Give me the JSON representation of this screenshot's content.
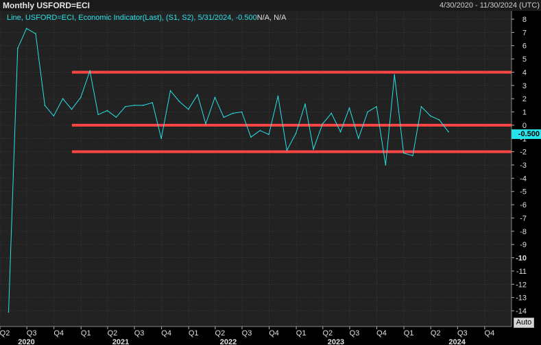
{
  "header": {
    "title": "Monthly USFORD=ECI",
    "date_range": "4/30/2020 - 11/30/2024 (UTC)"
  },
  "legend": {
    "text": "Line, USFORD=ECI, Economic Indicator(Last), (S1, S2), 5/31/2024, -0.500",
    "na_text": "N/A, N/A"
  },
  "last_value_label": "-0.500",
  "auto_label": "Auto",
  "colors": {
    "background": "#000000",
    "plot_background": "#222222",
    "grid": "#3a3a3a",
    "series": "#29e3ea",
    "horizontal_lines": "#ff4444",
    "axis_text": "#e0e0e0"
  },
  "chart_data": {
    "type": "line",
    "title": "Monthly USFORD=ECI",
    "ylim": [
      -14.5,
      8.5
    ],
    "y_ticks": [
      8,
      7,
      6,
      5,
      4,
      3,
      2,
      1,
      0,
      -1,
      -2,
      -3,
      -4,
      -5,
      -6,
      -7,
      -8,
      -9,
      -10,
      -11,
      -12,
      -13,
      -14
    ],
    "x_range": [
      "2020-04-01",
      "2024-12-31"
    ],
    "x_quarter_ticks": [
      {
        "label": "Q2",
        "date": "2020-04-01"
      },
      {
        "label": "Q3",
        "date": "2020-07-01"
      },
      {
        "label": "Q4",
        "date": "2020-10-01"
      },
      {
        "label": "Q1",
        "date": "2021-01-01"
      },
      {
        "label": "Q2",
        "date": "2021-04-01"
      },
      {
        "label": "Q3",
        "date": "2021-07-01"
      },
      {
        "label": "Q4",
        "date": "2021-10-01"
      },
      {
        "label": "Q1",
        "date": "2022-01-01"
      },
      {
        "label": "Q2",
        "date": "2022-04-01"
      },
      {
        "label": "Q3",
        "date": "2022-07-01"
      },
      {
        "label": "Q4",
        "date": "2022-10-01"
      },
      {
        "label": "Q1",
        "date": "2023-01-01"
      },
      {
        "label": "Q2",
        "date": "2023-04-01"
      },
      {
        "label": "Q3",
        "date": "2023-07-01"
      },
      {
        "label": "Q4",
        "date": "2023-10-01"
      },
      {
        "label": "Q1",
        "date": "2024-01-01"
      },
      {
        "label": "Q2",
        "date": "2024-04-01"
      },
      {
        "label": "Q3",
        "date": "2024-07-01"
      },
      {
        "label": "Q4",
        "date": "2024-10-01"
      }
    ],
    "x_year_labels": [
      {
        "label": "2020",
        "date": "2020-08-15"
      },
      {
        "label": "2021",
        "date": "2021-07-01"
      },
      {
        "label": "2022",
        "date": "2022-07-01"
      },
      {
        "label": "2023",
        "date": "2023-07-01"
      },
      {
        "label": "2024",
        "date": "2024-08-15"
      }
    ],
    "series": [
      {
        "x": [
          "2020-04-30",
          "2020-05-31",
          "2020-06-30",
          "2020-07-31",
          "2020-08-31",
          "2020-09-30",
          "2020-10-31",
          "2020-11-30",
          "2020-12-31",
          "2021-01-31",
          "2021-02-28",
          "2021-03-31",
          "2021-04-30",
          "2021-05-31",
          "2021-06-30",
          "2021-07-31",
          "2021-08-31",
          "2021-09-30",
          "2021-10-31",
          "2021-11-30",
          "2021-12-31",
          "2022-01-31",
          "2022-02-28",
          "2022-03-31",
          "2022-04-30",
          "2022-05-31",
          "2022-06-30",
          "2022-07-31",
          "2022-08-31",
          "2022-09-30",
          "2022-10-31",
          "2022-11-30",
          "2022-12-31",
          "2023-01-31",
          "2023-02-28",
          "2023-03-31",
          "2023-04-30",
          "2023-05-31",
          "2023-06-30",
          "2023-07-31",
          "2023-08-31",
          "2023-09-30",
          "2023-10-31",
          "2023-11-30",
          "2023-12-31",
          "2024-01-31",
          "2024-02-29",
          "2024-03-31",
          "2024-04-30",
          "2024-05-31"
        ],
        "values": [
          -14.1,
          5.8,
          7.3,
          6.9,
          1.5,
          0.7,
          2.0,
          1.2,
          2.1,
          4.1,
          0.8,
          1.1,
          0.6,
          1.4,
          1.5,
          1.5,
          1.7,
          -1.0,
          2.6,
          1.8,
          1.2,
          2.3,
          0.1,
          2.1,
          0.6,
          0.9,
          1.0,
          -0.9,
          -0.4,
          -0.7,
          2.2,
          -1.9,
          -0.6,
          1.6,
          -1.8,
          0.1,
          0.9,
          -0.5,
          1.3,
          -1.0,
          1.0,
          1.4,
          -3.0,
          3.8,
          -2.1,
          -2.3,
          1.4,
          0.7,
          0.4,
          -0.5
        ]
      }
    ],
    "horizontal_lines": [
      4,
      0,
      -2
    ],
    "grid": true
  }
}
